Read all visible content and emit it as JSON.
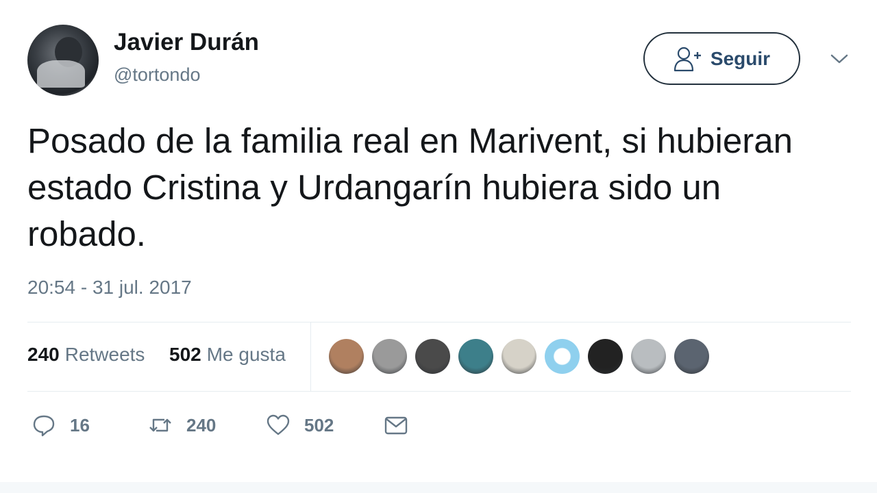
{
  "user": {
    "name": "Javier Durán",
    "handle": "@tortondo"
  },
  "follow_button": {
    "label": "Seguir",
    "icon": "add-user-icon"
  },
  "menu_icon": "chevron-down-icon",
  "tweet": {
    "text": "Posado de la familia real en Marivent, si hubieran estado Cristina y Urdangarín hubiera sido un robado.",
    "timestamp": "20:54 - 31 jul. 2017"
  },
  "stats": {
    "retweets_count": "240",
    "retweets_label": "Retweets",
    "likes_count": "502",
    "likes_label": "Me gusta"
  },
  "likers": [
    {
      "icon": "avatar",
      "color": "#b08060"
    },
    {
      "icon": "avatar",
      "color": "#9a9a9a"
    },
    {
      "icon": "avatar",
      "color": "#4a4a4a"
    },
    {
      "icon": "avatar",
      "color": "#3d7f8a"
    },
    {
      "icon": "avatar",
      "color": "#d6d2c8"
    },
    {
      "icon": "avatar",
      "color": "#8fd0ee"
    },
    {
      "icon": "avatar",
      "color": "#222222"
    },
    {
      "icon": "avatar",
      "color": "#b9bdc0"
    },
    {
      "icon": "avatar",
      "color": "#5b6470"
    }
  ],
  "actions": {
    "reply_count": "16",
    "retweet_count": "240",
    "like_count": "502"
  },
  "colors": {
    "text": "#14171a",
    "secondary": "#657786",
    "button_text": "#2a4a6b"
  }
}
